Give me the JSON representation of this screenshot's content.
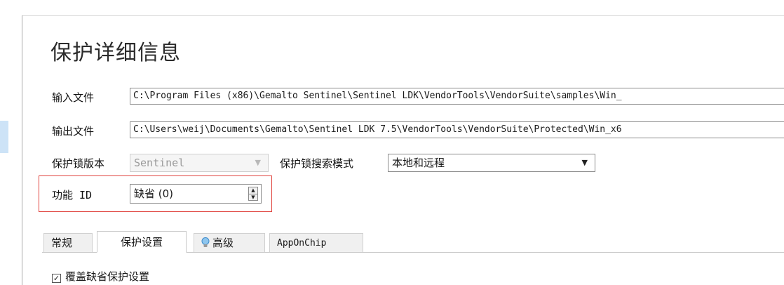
{
  "title": "保护详细信息",
  "input_file": {
    "label": "输入文件",
    "value": "C:\\Program Files (x86)\\Gemalto Sentinel\\Sentinel LDK\\VendorTools\\VendorSuite\\samples\\Win_"
  },
  "output_file": {
    "label": "输出文件",
    "value": "C:\\Users\\weij\\Documents\\Gemalto\\Sentinel LDK 7.5\\VendorTools\\VendorSuite\\Protected\\Win_x6"
  },
  "lock_version": {
    "label": "保护锁版本",
    "value": "Sentinel"
  },
  "lock_search_mode": {
    "label": "保护锁搜索模式",
    "value": "本地和远程"
  },
  "feature_id": {
    "label": "功能 ID",
    "value": "缺省 (0)"
  },
  "tabs": [
    {
      "label": "常规",
      "active": false
    },
    {
      "label": "保护设置",
      "active": true
    },
    {
      "label": "高级",
      "active": false,
      "icon": "lightbulb-icon"
    },
    {
      "label": "AppOnChip",
      "active": false
    }
  ],
  "override_checkbox": {
    "label": "覆盖缺省保护设置",
    "checked": true
  },
  "colors": {
    "highlight": "#e0443e",
    "selection": "#cde3f7"
  }
}
